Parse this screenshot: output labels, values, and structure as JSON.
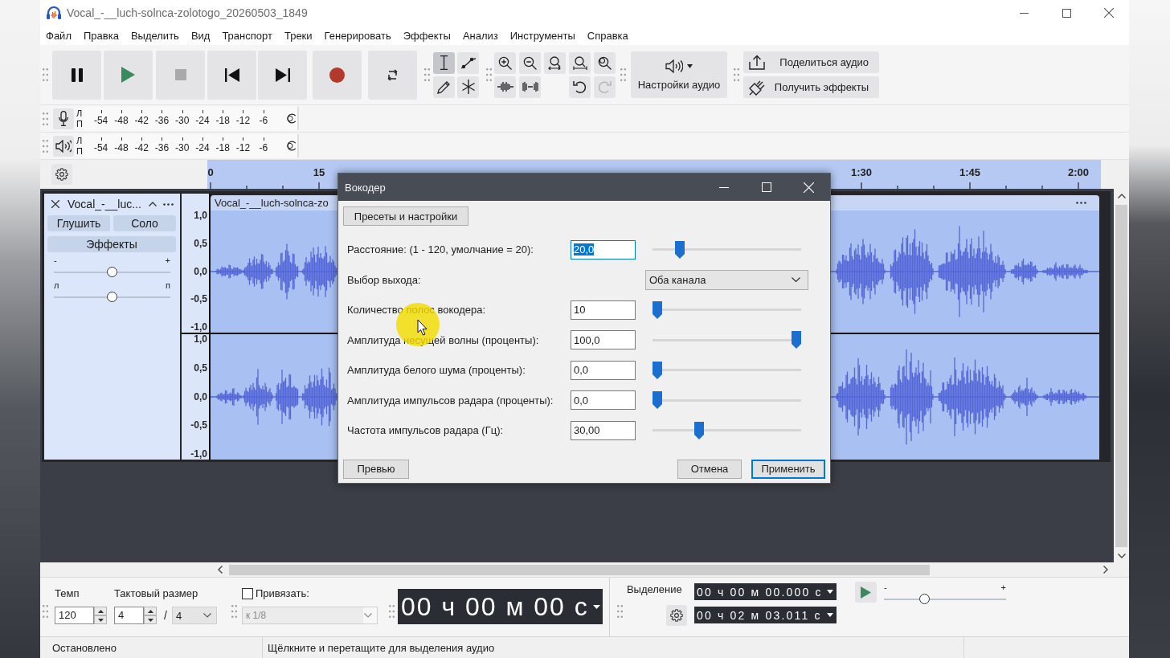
{
  "window": {
    "title": "Vocal_-__luch-solnca-zolotogo_20260503_1849"
  },
  "menu": [
    "Файл",
    "Правка",
    "Выделить",
    "Вид",
    "Транспорт",
    "Треки",
    "Генерировать",
    "Эффекты",
    "Анализ",
    "Инструменты",
    "Справка"
  ],
  "transport": [
    {
      "disabled": false
    },
    {
      "disabled": false
    },
    {
      "disabled": true
    },
    {
      "disabled": false
    },
    {
      "disabled": false
    },
    {
      "disabled": false
    },
    {
      "disabled": false
    }
  ],
  "tools": [
    {
      "selected": true
    },
    {
      "selected": false
    },
    {
      "selected": false
    },
    {
      "selected": false
    }
  ],
  "history": [
    {
      "disabled": false
    },
    {
      "disabled": true
    }
  ],
  "audio_setup": "Настройки аудио",
  "share": [
    "Поделиться аудио",
    "Получить эффекты"
  ],
  "meters": [
    {
      "channels": [
        "Л",
        "П"
      ],
      "scale": [
        "-54",
        "-48",
        "-42",
        "-36",
        "-30",
        "-24",
        "-18",
        "-12",
        "-6"
      ]
    },
    {
      "channels": [
        "Л",
        "П"
      ],
      "scale": [
        "-54",
        "-48",
        "-42",
        "-36",
        "-30",
        "-24",
        "-18",
        "-12",
        "-6"
      ]
    }
  ],
  "ruler": [
    "0",
    "15",
    "1:30",
    "1:45",
    "2:00"
  ],
  "track": {
    "name": "Vocal_-__luc...",
    "buttons": [
      "Глушить",
      "Соло"
    ],
    "effects": "Эффекты",
    "gain": {
      "min": "-",
      "max": "+",
      "level": 0.5
    },
    "pan": {
      "min": "л",
      "max": "п",
      "level": 0.5
    },
    "clip": "Vocal_-__luch-solnca-zo",
    "channels": [
      {
        "scale": [
          "1,0",
          "0,5",
          "0,0",
          "-0,5",
          "-1,0"
        ]
      },
      {
        "scale": [
          "1,0",
          "0,5",
          "0,0",
          "-0,5",
          "-1,0"
        ]
      }
    ]
  },
  "dialog": {
    "title": "Вокодер",
    "presets": "Пресеты и настройки",
    "params": [
      {
        "kind": "slider",
        "label": "Расстояние: (1 - 120, умолчание = 20):",
        "value": "20,0",
        "focused": true,
        "level": 0.16
      },
      {
        "kind": "choice",
        "label": "Выбор выхода:",
        "value": "Оба канала"
      },
      {
        "kind": "slider",
        "label": "Количество полос вокодера:",
        "value": "10",
        "focused": false,
        "level": 0
      },
      {
        "kind": "slider",
        "label": "Амплитуда несущей волны (проценты):",
        "value": "100,0",
        "focused": false,
        "level": 1
      },
      {
        "kind": "slider",
        "label": "Амплитуда белого шума (проценты):",
        "value": "0,0",
        "focused": false,
        "level": 0
      },
      {
        "kind": "slider",
        "label": "Амплитуда импульсов радара (проценты):",
        "value": "0,0",
        "focused": false,
        "level": 0
      },
      {
        "kind": "slider",
        "label": "Частота импульсов радара (Гц):",
        "value": "30,00",
        "focused": false,
        "level": 0.3
      }
    ],
    "buttons": [
      {
        "label": "Превью",
        "default": false
      },
      {
        "label": "Отмена",
        "default": false
      },
      {
        "label": "Применить",
        "default": true
      }
    ]
  },
  "bottom": {
    "tempo": {
      "label": "Темп",
      "value": "120"
    },
    "signature": {
      "label": "Тактовый размер",
      "upper": "4",
      "separator": "/",
      "lower": "4"
    },
    "snap": {
      "label": "Привязать:",
      "checked": false,
      "value": "к 1/8",
      "disabled": true
    },
    "time": "00 ч 00 м 00 с",
    "selection": {
      "label": "Выделение",
      "start": "00 ч 00 м 00.000 с",
      "end": "00 ч 02 м 03.011 с"
    },
    "speed": {
      "min": "-",
      "max": "+",
      "level": 0.32
    }
  },
  "status": [
    "Остановлено",
    "Щёлкните и перетащите для выделения аудио"
  ]
}
